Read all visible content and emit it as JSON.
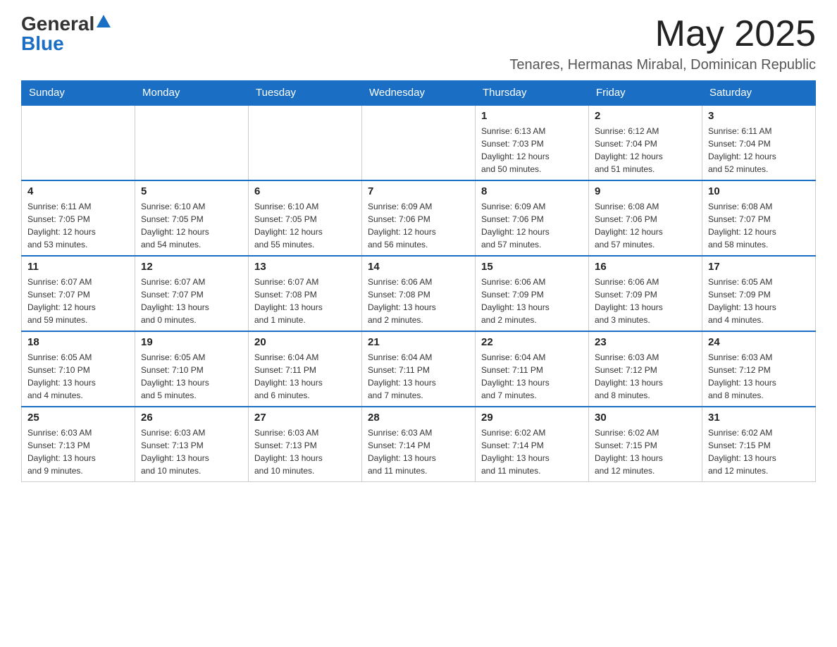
{
  "header": {
    "logo_general": "General",
    "logo_blue": "Blue",
    "month_year": "May 2025",
    "location": "Tenares, Hermanas Mirabal, Dominican Republic"
  },
  "weekdays": [
    "Sunday",
    "Monday",
    "Tuesday",
    "Wednesday",
    "Thursday",
    "Friday",
    "Saturday"
  ],
  "weeks": [
    [
      {
        "day": "",
        "info": ""
      },
      {
        "day": "",
        "info": ""
      },
      {
        "day": "",
        "info": ""
      },
      {
        "day": "",
        "info": ""
      },
      {
        "day": "1",
        "info": "Sunrise: 6:13 AM\nSunset: 7:03 PM\nDaylight: 12 hours\nand 50 minutes."
      },
      {
        "day": "2",
        "info": "Sunrise: 6:12 AM\nSunset: 7:04 PM\nDaylight: 12 hours\nand 51 minutes."
      },
      {
        "day": "3",
        "info": "Sunrise: 6:11 AM\nSunset: 7:04 PM\nDaylight: 12 hours\nand 52 minutes."
      }
    ],
    [
      {
        "day": "4",
        "info": "Sunrise: 6:11 AM\nSunset: 7:05 PM\nDaylight: 12 hours\nand 53 minutes."
      },
      {
        "day": "5",
        "info": "Sunrise: 6:10 AM\nSunset: 7:05 PM\nDaylight: 12 hours\nand 54 minutes."
      },
      {
        "day": "6",
        "info": "Sunrise: 6:10 AM\nSunset: 7:05 PM\nDaylight: 12 hours\nand 55 minutes."
      },
      {
        "day": "7",
        "info": "Sunrise: 6:09 AM\nSunset: 7:06 PM\nDaylight: 12 hours\nand 56 minutes."
      },
      {
        "day": "8",
        "info": "Sunrise: 6:09 AM\nSunset: 7:06 PM\nDaylight: 12 hours\nand 57 minutes."
      },
      {
        "day": "9",
        "info": "Sunrise: 6:08 AM\nSunset: 7:06 PM\nDaylight: 12 hours\nand 57 minutes."
      },
      {
        "day": "10",
        "info": "Sunrise: 6:08 AM\nSunset: 7:07 PM\nDaylight: 12 hours\nand 58 minutes."
      }
    ],
    [
      {
        "day": "11",
        "info": "Sunrise: 6:07 AM\nSunset: 7:07 PM\nDaylight: 12 hours\nand 59 minutes."
      },
      {
        "day": "12",
        "info": "Sunrise: 6:07 AM\nSunset: 7:07 PM\nDaylight: 13 hours\nand 0 minutes."
      },
      {
        "day": "13",
        "info": "Sunrise: 6:07 AM\nSunset: 7:08 PM\nDaylight: 13 hours\nand 1 minute."
      },
      {
        "day": "14",
        "info": "Sunrise: 6:06 AM\nSunset: 7:08 PM\nDaylight: 13 hours\nand 2 minutes."
      },
      {
        "day": "15",
        "info": "Sunrise: 6:06 AM\nSunset: 7:09 PM\nDaylight: 13 hours\nand 2 minutes."
      },
      {
        "day": "16",
        "info": "Sunrise: 6:06 AM\nSunset: 7:09 PM\nDaylight: 13 hours\nand 3 minutes."
      },
      {
        "day": "17",
        "info": "Sunrise: 6:05 AM\nSunset: 7:09 PM\nDaylight: 13 hours\nand 4 minutes."
      }
    ],
    [
      {
        "day": "18",
        "info": "Sunrise: 6:05 AM\nSunset: 7:10 PM\nDaylight: 13 hours\nand 4 minutes."
      },
      {
        "day": "19",
        "info": "Sunrise: 6:05 AM\nSunset: 7:10 PM\nDaylight: 13 hours\nand 5 minutes."
      },
      {
        "day": "20",
        "info": "Sunrise: 6:04 AM\nSunset: 7:11 PM\nDaylight: 13 hours\nand 6 minutes."
      },
      {
        "day": "21",
        "info": "Sunrise: 6:04 AM\nSunset: 7:11 PM\nDaylight: 13 hours\nand 7 minutes."
      },
      {
        "day": "22",
        "info": "Sunrise: 6:04 AM\nSunset: 7:11 PM\nDaylight: 13 hours\nand 7 minutes."
      },
      {
        "day": "23",
        "info": "Sunrise: 6:03 AM\nSunset: 7:12 PM\nDaylight: 13 hours\nand 8 minutes."
      },
      {
        "day": "24",
        "info": "Sunrise: 6:03 AM\nSunset: 7:12 PM\nDaylight: 13 hours\nand 8 minutes."
      }
    ],
    [
      {
        "day": "25",
        "info": "Sunrise: 6:03 AM\nSunset: 7:13 PM\nDaylight: 13 hours\nand 9 minutes."
      },
      {
        "day": "26",
        "info": "Sunrise: 6:03 AM\nSunset: 7:13 PM\nDaylight: 13 hours\nand 10 minutes."
      },
      {
        "day": "27",
        "info": "Sunrise: 6:03 AM\nSunset: 7:13 PM\nDaylight: 13 hours\nand 10 minutes."
      },
      {
        "day": "28",
        "info": "Sunrise: 6:03 AM\nSunset: 7:14 PM\nDaylight: 13 hours\nand 11 minutes."
      },
      {
        "day": "29",
        "info": "Sunrise: 6:02 AM\nSunset: 7:14 PM\nDaylight: 13 hours\nand 11 minutes."
      },
      {
        "day": "30",
        "info": "Sunrise: 6:02 AM\nSunset: 7:15 PM\nDaylight: 13 hours\nand 12 minutes."
      },
      {
        "day": "31",
        "info": "Sunrise: 6:02 AM\nSunset: 7:15 PM\nDaylight: 13 hours\nand 12 minutes."
      }
    ]
  ]
}
